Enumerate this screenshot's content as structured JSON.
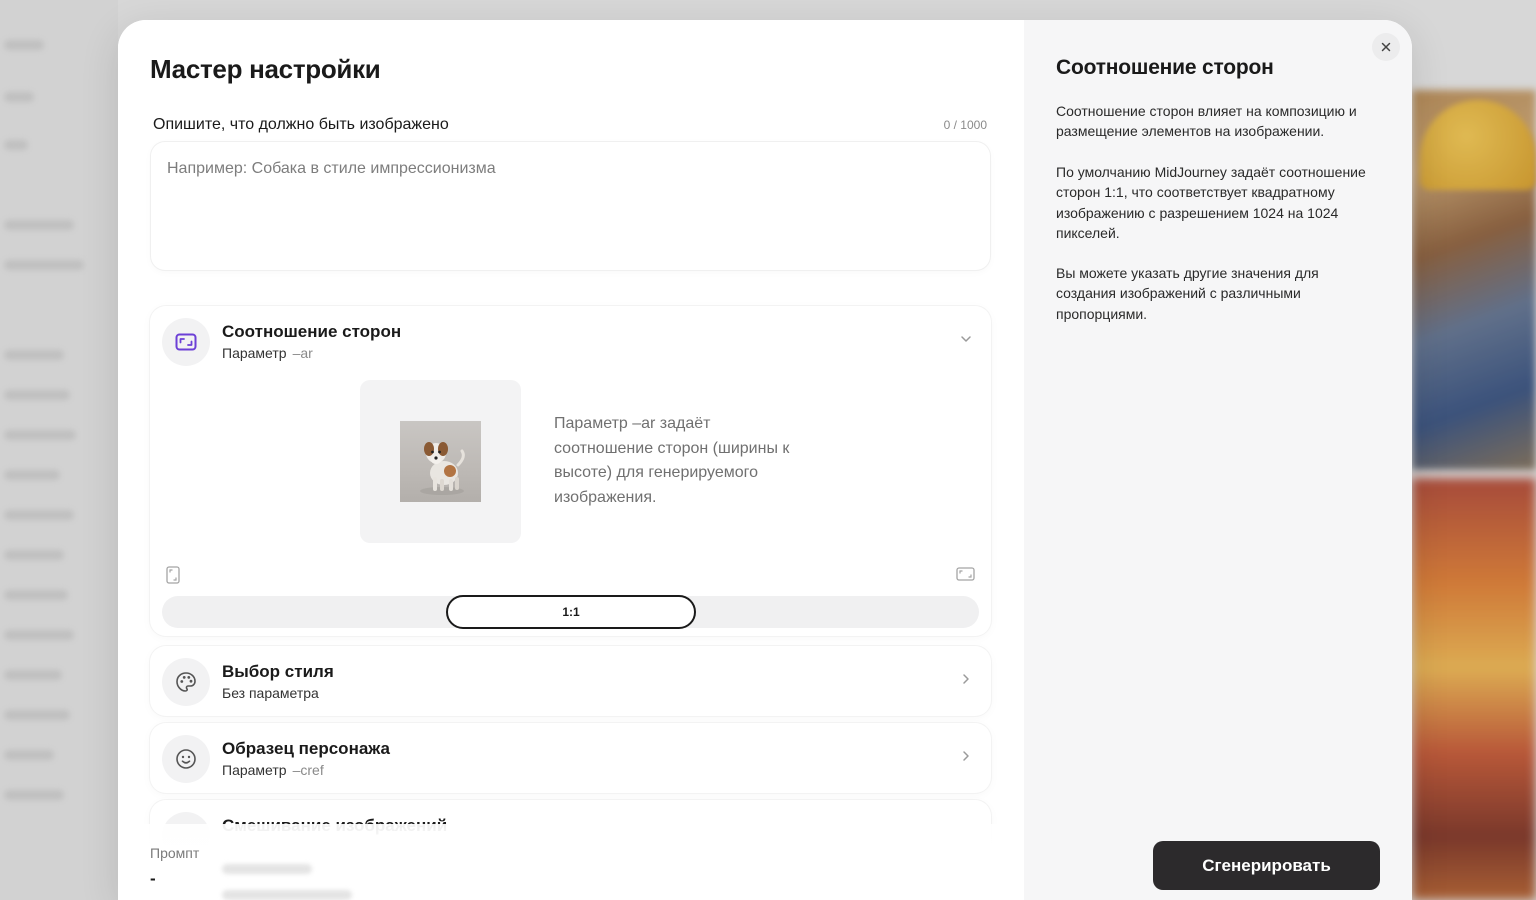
{
  "modal": {
    "title": "Мастер настройки",
    "close_icon": "close-icon"
  },
  "description": {
    "label": "Опишите, что должно быть изображено",
    "counter": "0 / 1000",
    "value": "",
    "placeholder": "Например: Собака в стиле импрессионизма"
  },
  "aspect_ratio": {
    "title": "Соотношение сторон",
    "sub_prefix": "Параметр",
    "param": "–ar",
    "icon": "aspect-ratio-icon",
    "expanded": true,
    "preview_text": "Параметр –ar задаёт соотношение сторон (ширины к высоте) для генерируемого изображения.",
    "slider_value": "1:1",
    "portrait_icon": "portrait-frame-icon",
    "landscape_icon": "landscape-frame-icon"
  },
  "style": {
    "title": "Выбор стиля",
    "sub": "Без параметра",
    "icon": "palette-icon"
  },
  "cref": {
    "title": "Образец персонажа",
    "sub_prefix": "Параметр",
    "param": "–cref",
    "icon": "smiley-icon"
  },
  "blend": {
    "title": "Смешивание изображений"
  },
  "footer": {
    "prompt_label": "Промпт",
    "prompt_value": "-",
    "generate_label": "Сгенерировать"
  },
  "help": {
    "title": "Соотношение сторон",
    "paragraphs": [
      "Соотношение сторон влияет на композицию и размещение элементов на изображении.",
      "По умолчанию MidJourney задаёт соотношение сторон 1:1, что соответствует квадратному изображению с разрешением 1024 на 1024 пикселей.",
      "Вы можете указать другие значения для создания изображений с различными пропорциями."
    ]
  },
  "colors": {
    "accent": "#6c3fd6",
    "primary_button": "#2c2a2c",
    "right_pane_bg": "#f6f6f7"
  }
}
